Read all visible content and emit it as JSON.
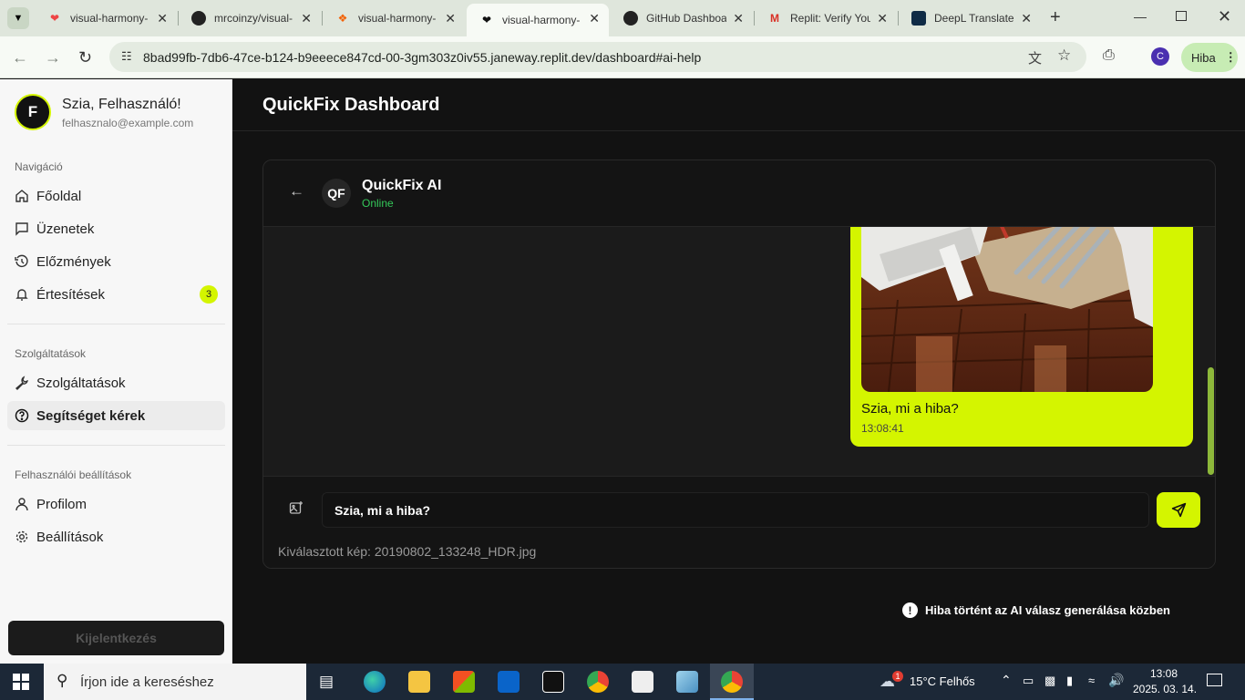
{
  "browser": {
    "tabs": [
      {
        "title": "visual-harmony-",
        "active": false
      },
      {
        "title": "mrcoinzy/visual-",
        "active": false
      },
      {
        "title": "visual-harmony-",
        "active": false
      },
      {
        "title": "visual-harmony-",
        "active": true
      },
      {
        "title": "GitHub Dashboar",
        "active": false
      },
      {
        "title": "Replit: Verify You",
        "active": false
      },
      {
        "title": "DeepL Translate:",
        "active": false
      }
    ],
    "url": "8bad99fb-7db6-47ce-b124-b9eeece847cd-00-3gm303z0iv55.janeway.replit.dev/dashboard#ai-help",
    "profile_initial": "C",
    "hiba_label": "Hiba"
  },
  "sidebar": {
    "avatar_initial": "F",
    "greeting": "Szia, Felhasználó!",
    "email": "felhasznalo@example.com",
    "sections": {
      "nav": "Navigáció",
      "services": "Szolgáltatások",
      "settings": "Felhasználói beállítások"
    },
    "items": {
      "home": "Főoldal",
      "messages": "Üzenetek",
      "history": "Előzmények",
      "notifications": "Értesítések",
      "notifications_badge": "3",
      "services": "Szolgáltatások",
      "help": "Segítséget kérek",
      "profile": "Profilom",
      "settings": "Beállítások"
    },
    "logout": "Kijelentkezés"
  },
  "main": {
    "title": "QuickFix Dashboard",
    "chat": {
      "bot_initials": "QF",
      "bot_name": "QuickFix AI",
      "bot_status": "Online",
      "message_text": "Szia, mi a hiba?",
      "message_time": "13:08:41",
      "input_value": "Szia, mi a hiba?",
      "selected_image": "Kiválasztott kép: 20190802_133248_HDR.jpg"
    },
    "error_toast": "Hiba történt az AI válasz generálása közben",
    "accent": "#d4f500"
  },
  "taskbar": {
    "search_placeholder": "Írjon ide a kereséshez",
    "weather": "15°C  Felhős",
    "weather_badge": "1",
    "time": "13:08",
    "date": "2025. 03. 14."
  }
}
